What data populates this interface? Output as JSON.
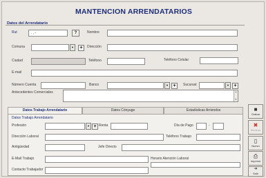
{
  "title": "MANTENCION ARRENDATARIOS",
  "datos_group": "Datos del Arrendatario",
  "rut": {
    "label": "Rut",
    "value": ". , -",
    "search_label": "?"
  },
  "nombre_label": "Nombre",
  "comuna_label": "Comuna",
  "direccion_label": "Dirección",
  "ciudad_label": "Ciudad",
  "telefono_label": "Teléfono",
  "celular_label": "Teléfono Celular",
  "email_label": "E-mail",
  "cuenta_label": "Número Cuenta",
  "banco_label": "Banco",
  "sucursal_label": "Sucursal",
  "antecedentes_label": "Antecedentes Comerciales",
  "tabs": [
    "Datos Trabajo Arrendatario",
    "Datos Cónyuge",
    "Estadísticas Arriendos"
  ],
  "trabajo": {
    "group": "Datos Trabajo Arrendatario",
    "profesion": "Profesión",
    "renta": "Renta",
    "dia_pago": "Día de Pago",
    "dia_sep": "-",
    "direccion": "Dirección Laboral",
    "telefono": "Teléfono Trabajo",
    "antiguedad": "Antigüedad",
    "sueldo": "Jefe Directo",
    "email": "E-Mail Trabajo",
    "horario": "Horario Atención Laboral",
    "contacto": "Contacto Trabajador"
  },
  "icons": {
    "dropdown": "▼",
    "plus": "+",
    "scroll_up": "▲",
    "scroll_down": "▼"
  },
  "buttons": {
    "grabar": {
      "label": "Grabar",
      "icon": "■"
    },
    "eliminar": {
      "label": "Eliminar",
      "icon": "✖"
    },
    "nuevo": {
      "label": "Nuevo",
      "icon": "▯"
    },
    "imprimir": {
      "label": "Imprimir",
      "icon": "⎙"
    },
    "salir": {
      "label": "Salir",
      "icon": "➜"
    }
  },
  "colors": {
    "title": "#1d2d7a",
    "disabled": "#a8a4a0",
    "delete_icon": "#c0392b"
  }
}
